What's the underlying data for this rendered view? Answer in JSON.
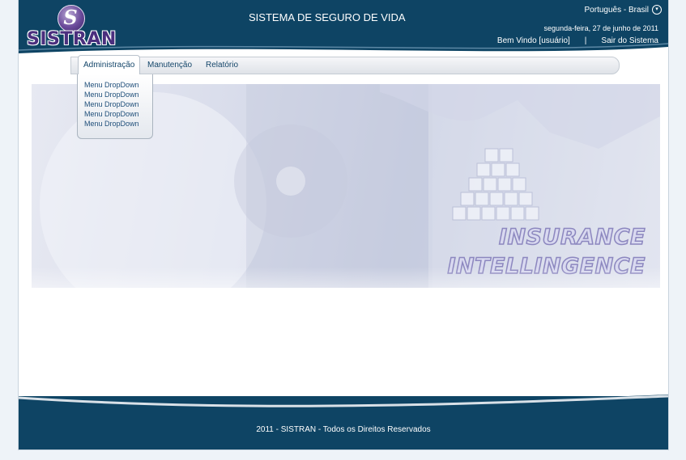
{
  "header": {
    "logo_text": "SISTRAN",
    "app_title": "SISTEMA DE SEGURO DE VIDA",
    "language": "Português - Brasil",
    "date": "segunda-feira, 27 de junho de 2011",
    "welcome": "Bem Vindo [usuário]",
    "separator": "|",
    "logout": "Sair do Sistema"
  },
  "menu": {
    "tabs": [
      {
        "label": "Administração"
      },
      {
        "label": "Manutenção"
      },
      {
        "label": "Relatório"
      }
    ],
    "dropdown": [
      "Menu DropDown",
      "Menu DropDown",
      "Menu DropDown",
      "Menu DropDown",
      "Menu DropDown"
    ]
  },
  "hero": {
    "line1": "INSURANCE",
    "line2": "INTELLINGENCE"
  },
  "footer": {
    "copyright": "2011 - SISTRAN - Todos os Direitos Reservados"
  },
  "colors": {
    "primary": "#0e4464",
    "logo": "#4b2f7e",
    "link": "#14466a"
  },
  "icons": {
    "language": "chevron-down-circle-icon",
    "logo": "sistran-s-logo"
  }
}
